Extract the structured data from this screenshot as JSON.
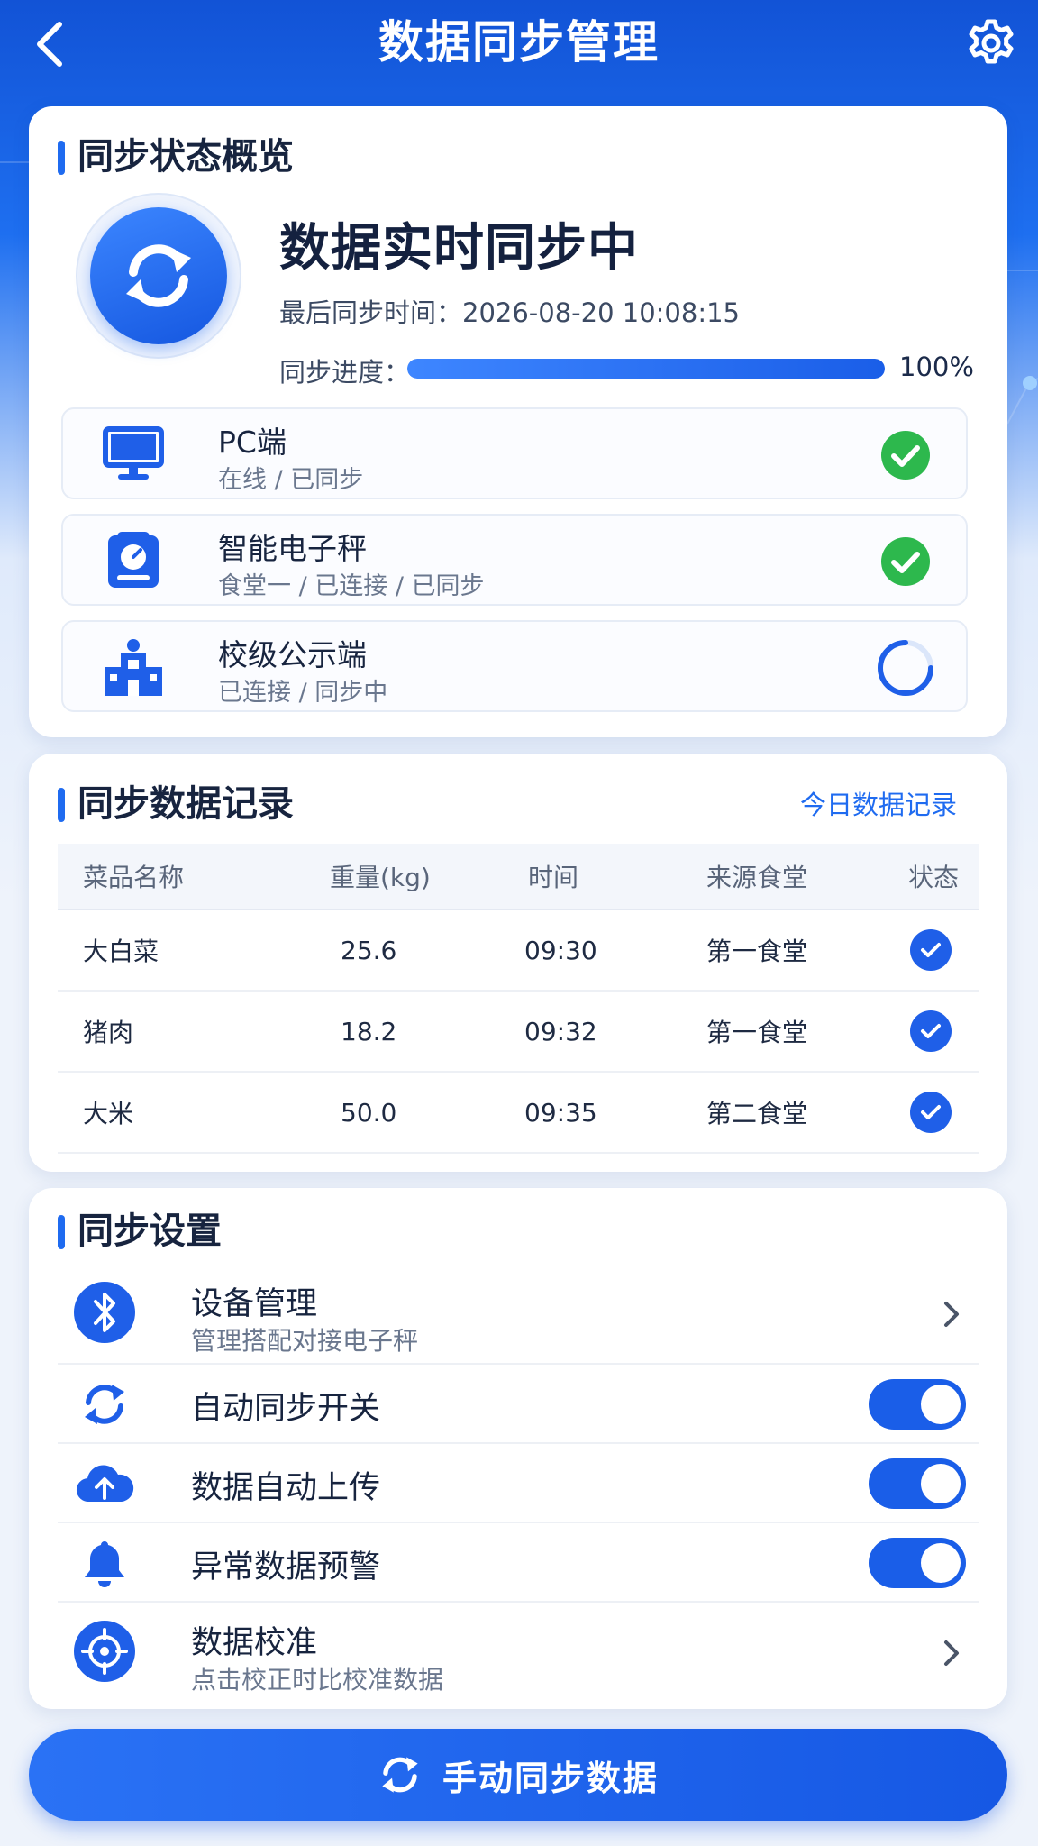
{
  "header": {
    "title": "数据同步管理"
  },
  "overview": {
    "section_title": "同步状态概览",
    "status_text": "数据实时同步中",
    "last_sync": "最后同步时间：2026-08-20 10:08:15",
    "progress_label": "同步进度：",
    "progress_percent": 100,
    "progress_text": "100%",
    "devices": [
      {
        "name": "PC端",
        "sub": "在线 / 已同步",
        "icon": "monitor-icon",
        "state": "synced"
      },
      {
        "name": "智能电子秤",
        "sub": "食堂一 / 已连接 / 已同步",
        "icon": "scale-icon",
        "state": "synced"
      },
      {
        "name": "校级公示端",
        "sub": "已连接 / 同步中",
        "icon": "school-building-icon",
        "state": "syncing"
      }
    ]
  },
  "records": {
    "section_title": "同步数据记录",
    "link_label": "今日数据记录",
    "columns": [
      "菜品名称",
      "重量(kg)",
      "时间",
      "来源食堂",
      "状态"
    ],
    "rows": [
      {
        "name": "大白菜",
        "weight": "25.6",
        "time": "09:30",
        "source": "第一食堂"
      },
      {
        "name": "猪肉",
        "weight": "18.2",
        "time": "09:32",
        "source": "第一食堂"
      },
      {
        "name": "大米",
        "weight": "50.0",
        "time": "09:35",
        "source": "第二食堂"
      }
    ]
  },
  "settings": {
    "section_title": "同步设置",
    "device_mgmt": {
      "title": "设备管理",
      "sub": "管理搭配对接电子秤"
    },
    "auto_sync": {
      "title": "自动同步开关",
      "on": true
    },
    "auto_upload": {
      "title": "数据自动上传",
      "on": true
    },
    "anomaly_alert": {
      "title": "异常数据预警",
      "on": true
    },
    "calibration": {
      "title": "数据校准",
      "sub": "点击校正时比校准数据"
    }
  },
  "action": {
    "manual_sync_label": "手动同步数据"
  },
  "colors": {
    "primary": "#1f6bf0",
    "success": "#2db84d",
    "header_bg": "#1253d6"
  }
}
